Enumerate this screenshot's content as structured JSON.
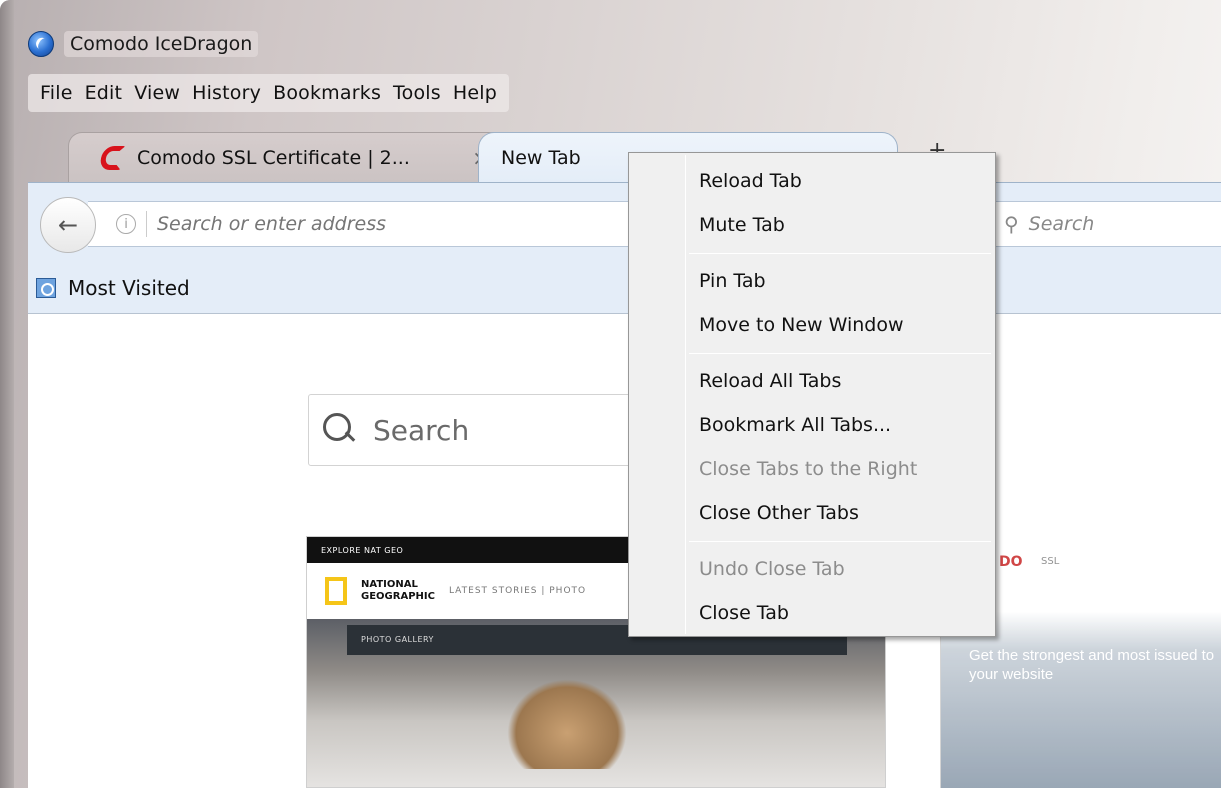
{
  "window": {
    "title": "Comodo IceDragon"
  },
  "menubar": [
    "File",
    "Edit",
    "View",
    "History",
    "Bookmarks",
    "Tools",
    "Help"
  ],
  "tabs": [
    {
      "label": "Comodo SSL Certificate | 2...",
      "active": false
    },
    {
      "label": "New Tab",
      "active": true
    }
  ],
  "navbar": {
    "url_placeholder": "Search or enter address",
    "search_placeholder": "Search"
  },
  "bookmarks": {
    "most_visited": "Most Visited"
  },
  "newtab": {
    "search_placeholder": "Search",
    "thumb1": {
      "top_bar": "EXPLORE NAT GEO",
      "logo_line1": "NATIONAL",
      "logo_line2": "GEOGRAPHIC",
      "nav": "LATEST STORIES  |  PHOTO",
      "gallery": "PHOTO GALLERY"
    },
    "thumb2": {
      "logo": "DO",
      "ssl": "SSL",
      "tagline": "Get the strongest and most issued to your website"
    }
  },
  "context_menu": {
    "items": [
      {
        "label": "Reload Tab",
        "enabled": true
      },
      {
        "label": "Mute Tab",
        "enabled": true
      },
      {
        "label": "Pin Tab",
        "enabled": true
      },
      {
        "label": "Move to New Window",
        "enabled": true
      },
      {
        "label": "Reload All Tabs",
        "enabled": true
      },
      {
        "label": "Bookmark All Tabs...",
        "enabled": true
      },
      {
        "label": "Close Tabs to the Right",
        "enabled": false
      },
      {
        "label": "Close Other Tabs",
        "enabled": true
      },
      {
        "label": "Undo Close Tab",
        "enabled": false
      },
      {
        "label": "Close Tab",
        "enabled": true
      }
    ]
  }
}
